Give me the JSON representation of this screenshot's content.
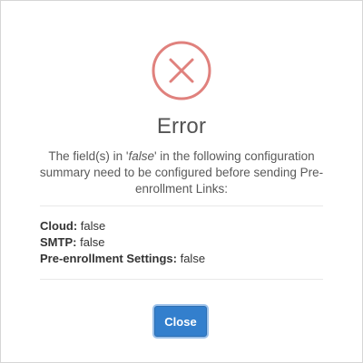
{
  "dialog": {
    "title": "Error",
    "message_prefix": "The field(s) in '",
    "message_highlight": "false",
    "message_suffix": "' in the following configuration summary need to be configured before sending Pre-enrollment Links:",
    "icon": "error-x-circle-icon",
    "icon_color": "#e0817d",
    "items": [
      {
        "label": "Cloud:",
        "value": "false"
      },
      {
        "label": "SMTP:",
        "value": "false"
      },
      {
        "label": "Pre-enrollment Settings:",
        "value": "false"
      }
    ],
    "close_label": "Close",
    "button_color": "#337fcd"
  }
}
